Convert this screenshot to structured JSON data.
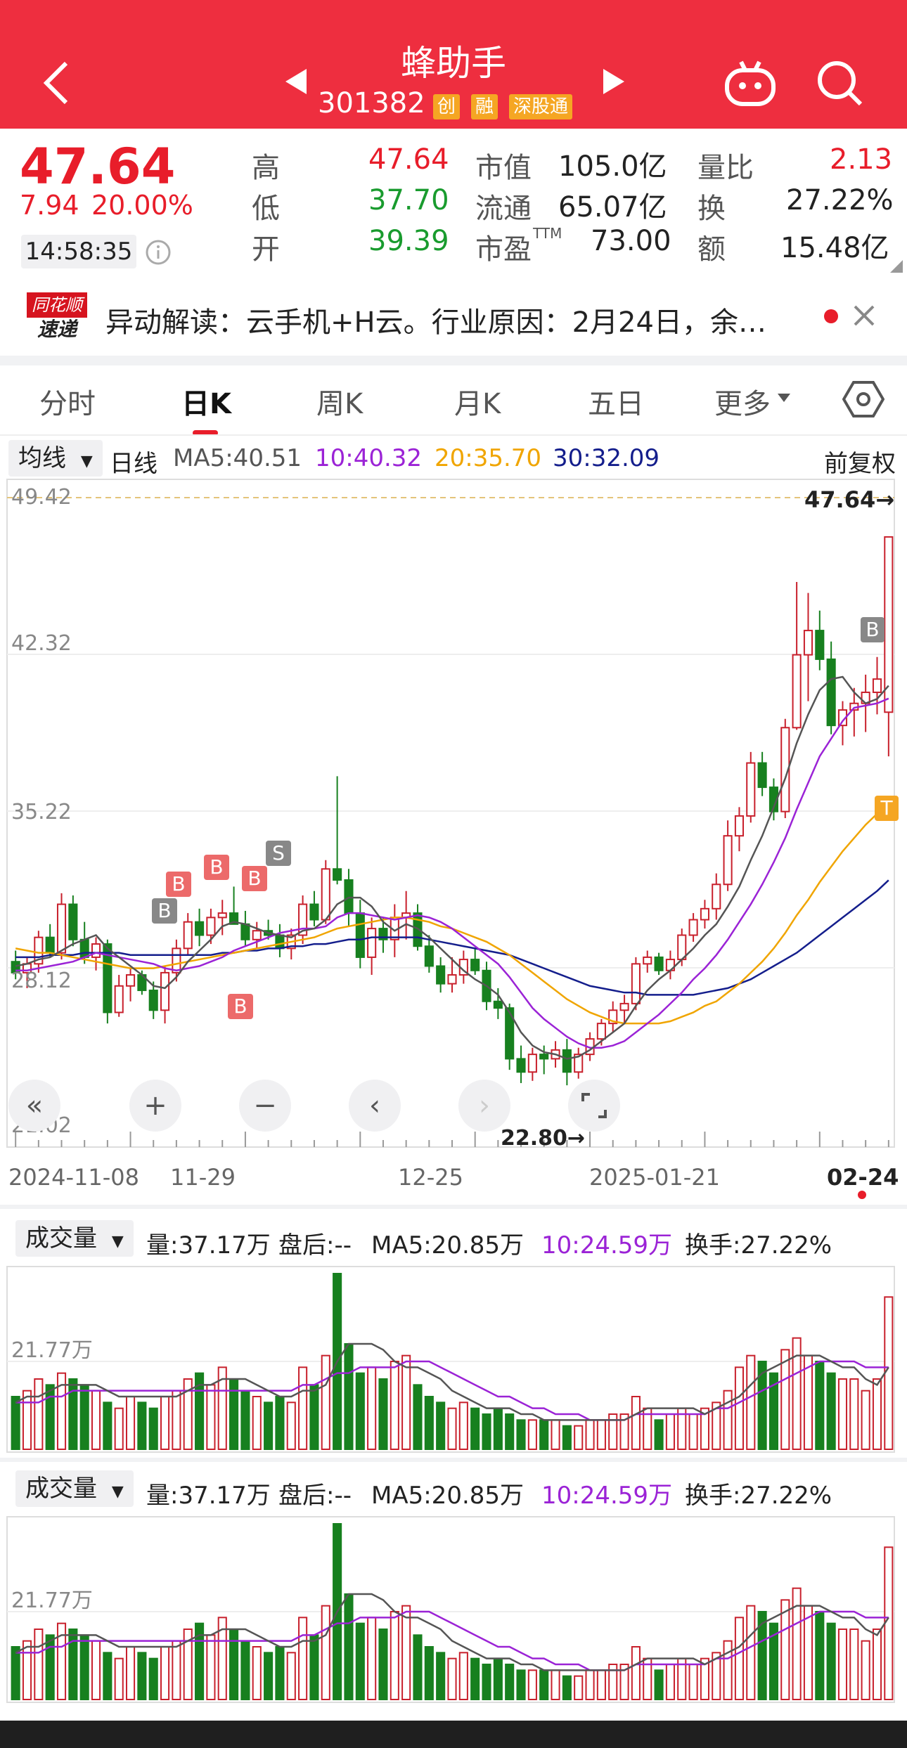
{
  "header": {
    "title": "蜂助手",
    "code": "301382",
    "tags": [
      "创",
      "融",
      "深股通"
    ]
  },
  "quote": {
    "price": "47.64",
    "change": "7.94",
    "change_pct": "20.00%",
    "time": "14:58:35",
    "high_label": "高",
    "high": "47.64",
    "low_label": "低",
    "low": "37.70",
    "open_label": "开",
    "open": "39.39",
    "mktcap_label": "市值",
    "mktcap": "105.0亿",
    "float_label": "流通",
    "float": "65.07亿",
    "pe_label": "市盈",
    "pe_sup": "TTM",
    "pe": "73.00",
    "volratio_label": "量比",
    "volratio": "2.13",
    "turnover_label": "换",
    "turnover": "27.22%",
    "amount_label": "额",
    "amount": "15.48亿"
  },
  "news": {
    "logo_top": "同花顺",
    "logo_bottom": "速递",
    "text": "异动解读：云手机+H云。行业原因：2月24日，余…"
  },
  "tabs": [
    "分时",
    "日K",
    "周K",
    "月K",
    "五日",
    "更多"
  ],
  "active_tab": 1,
  "ma_line": {
    "dropdown": "均线",
    "kind": "日线",
    "ma5": "MA5:40.51",
    "ma10": "10:40.32",
    "ma20": "20:35.70",
    "ma30": "30:32.09",
    "adjust": "前复权"
  },
  "kline": {
    "y_labels": [
      "49.42",
      "42.32",
      "35.22",
      "28.12",
      "21.02"
    ],
    "last_marker": "47.64→",
    "low_marker": "22.80→",
    "dates": [
      "2024-11-08",
      "11-29",
      "12-25",
      "2025-01-21",
      "02-24"
    ],
    "signals": [
      "B",
      "B",
      "B",
      "B",
      "B",
      "S",
      "B",
      "T"
    ]
  },
  "chart_data": {
    "type": "candlestick",
    "ylim": [
      21.02,
      49.42
    ],
    "ohlc": [
      [
        28.4,
        28.9,
        27.6,
        27.9
      ],
      [
        27.9,
        28.6,
        27.2,
        28.3
      ],
      [
        28.3,
        29.8,
        27.9,
        29.5
      ],
      [
        29.5,
        30.1,
        28.6,
        28.8
      ],
      [
        28.8,
        31.5,
        28.5,
        31.0
      ],
      [
        31.0,
        31.4,
        29.1,
        29.4
      ],
      [
        29.4,
        30.2,
        28.3,
        28.6
      ],
      [
        28.6,
        29.5,
        28.0,
        29.2
      ],
      [
        29.2,
        29.4,
        25.6,
        26.1
      ],
      [
        26.1,
        27.8,
        25.9,
        27.3
      ],
      [
        27.3,
        28.1,
        26.6,
        27.8
      ],
      [
        27.8,
        28.0,
        26.9,
        27.1
      ],
      [
        27.1,
        27.5,
        25.8,
        26.2
      ],
      [
        26.2,
        28.2,
        25.6,
        27.9
      ],
      [
        27.9,
        29.4,
        27.5,
        29.0
      ],
      [
        29.0,
        30.6,
        28.7,
        30.2
      ],
      [
        30.2,
        30.8,
        29.1,
        29.6
      ],
      [
        29.6,
        30.8,
        29.2,
        30.4
      ],
      [
        30.4,
        31.2,
        29.6,
        30.6
      ],
      [
        30.6,
        31.8,
        30.2,
        30.1
      ],
      [
        30.1,
        30.7,
        29.1,
        29.4
      ],
      [
        29.4,
        30.2,
        29.0,
        29.8
      ],
      [
        29.8,
        30.3,
        29.4,
        29.6
      ],
      [
        29.6,
        30.1,
        28.6,
        29.0
      ],
      [
        29.0,
        29.9,
        28.5,
        29.6
      ],
      [
        29.6,
        31.4,
        29.2,
        31.0
      ],
      [
        31.0,
        31.6,
        30.0,
        30.3
      ],
      [
        30.3,
        33.0,
        30.1,
        32.6
      ],
      [
        32.6,
        36.8,
        31.9,
        32.1
      ],
      [
        32.1,
        32.6,
        30.0,
        30.6
      ],
      [
        30.6,
        31.2,
        28.1,
        28.6
      ],
      [
        28.6,
        30.4,
        27.8,
        29.9
      ],
      [
        29.9,
        30.4,
        28.8,
        29.4
      ],
      [
        29.4,
        31.0,
        28.6,
        30.4
      ],
      [
        30.4,
        31.6,
        29.4,
        30.6
      ],
      [
        30.6,
        31.0,
        28.9,
        29.1
      ],
      [
        29.1,
        29.6,
        27.9,
        28.2
      ],
      [
        28.2,
        28.6,
        27.0,
        27.4
      ],
      [
        27.4,
        28.6,
        27.0,
        27.8
      ],
      [
        27.8,
        28.9,
        27.4,
        28.5
      ],
      [
        28.5,
        29.0,
        27.8,
        28.0
      ],
      [
        28.0,
        28.4,
        26.2,
        26.6
      ],
      [
        26.6,
        27.2,
        25.8,
        26.3
      ],
      [
        26.3,
        26.5,
        23.5,
        24.0
      ],
      [
        24.0,
        24.6,
        22.9,
        23.4
      ],
      [
        23.4,
        24.5,
        23.0,
        24.2
      ],
      [
        24.2,
        24.6,
        23.3,
        24.0
      ],
      [
        24.0,
        24.8,
        23.6,
        24.4
      ],
      [
        24.4,
        24.9,
        22.8,
        23.4
      ],
      [
        23.4,
        24.5,
        23.1,
        24.2
      ],
      [
        24.2,
        25.2,
        23.9,
        24.9
      ],
      [
        24.9,
        25.8,
        24.6,
        25.6
      ],
      [
        25.6,
        26.6,
        25.2,
        26.2
      ],
      [
        26.2,
        26.9,
        25.6,
        26.5
      ],
      [
        26.5,
        28.6,
        26.2,
        28.3
      ],
      [
        28.3,
        28.9,
        27.9,
        28.6
      ],
      [
        28.6,
        28.8,
        27.8,
        28.0
      ],
      [
        28.0,
        28.9,
        27.6,
        28.5
      ],
      [
        28.5,
        29.9,
        28.2,
        29.6
      ],
      [
        29.6,
        30.6,
        29.3,
        30.3
      ],
      [
        30.3,
        31.2,
        29.9,
        30.8
      ],
      [
        30.8,
        32.4,
        30.3,
        31.9
      ],
      [
        31.9,
        34.8,
        31.6,
        34.1
      ],
      [
        34.1,
        35.4,
        33.4,
        35.0
      ],
      [
        35.0,
        37.9,
        34.7,
        37.4
      ],
      [
        37.4,
        37.9,
        35.9,
        36.3
      ],
      [
        36.3,
        36.7,
        34.8,
        35.2
      ],
      [
        35.2,
        39.4,
        34.9,
        39.0
      ],
      [
        39.0,
        45.6,
        38.9,
        42.3
      ],
      [
        42.3,
        45.1,
        40.2,
        43.4
      ],
      [
        43.4,
        44.3,
        41.6,
        42.1
      ],
      [
        42.1,
        42.9,
        38.7,
        39.1
      ],
      [
        39.1,
        40.2,
        38.2,
        39.8
      ],
      [
        39.8,
        40.8,
        38.6,
        40.1
      ],
      [
        40.1,
        41.4,
        38.8,
        40.6
      ],
      [
        40.6,
        42.2,
        39.6,
        41.2
      ],
      [
        39.7,
        47.64,
        37.7,
        47.64
      ]
    ],
    "ma5": [
      28.2,
      28.3,
      28.5,
      28.6,
      28.9,
      29.2,
      29.4,
      29.6,
      29.0,
      28.6,
      28.2,
      27.8,
      27.3,
      27.2,
      27.7,
      28.4,
      28.9,
      29.4,
      30.0,
      30.2,
      30.1,
      29.9,
      29.7,
      29.6,
      29.5,
      29.8,
      29.9,
      30.3,
      31.0,
      31.3,
      31.3,
      30.9,
      30.2,
      29.8,
      30.1,
      29.9,
      29.5,
      29.0,
      28.5,
      28.0,
      27.6,
      27.3,
      26.9,
      26.1,
      25.2,
      24.6,
      24.3,
      24.2,
      24.0,
      24.1,
      24.4,
      24.8,
      25.2,
      25.6,
      26.4,
      27.1,
      27.6,
      28.0,
      28.5,
      29.0,
      29.6,
      30.1,
      30.9,
      31.8,
      33.0,
      34.1,
      35.4,
      36.7,
      38.3,
      39.6,
      40.7,
      41.2,
      41.3,
      40.6,
      40.1,
      40.3,
      40.9
    ],
    "ma10": [
      28.0,
      28.0,
      28.1,
      28.2,
      28.3,
      28.4,
      28.6,
      28.8,
      28.7,
      28.6,
      28.5,
      28.4,
      28.3,
      28.1,
      28.0,
      28.1,
      28.2,
      28.4,
      28.6,
      28.9,
      29.1,
      29.3,
      29.5,
      29.7,
      29.8,
      29.9,
      29.9,
      30.0,
      30.4,
      30.6,
      30.6,
      30.5,
      30.4,
      30.3,
      30.4,
      30.5,
      30.4,
      30.2,
      29.9,
      29.5,
      29.1,
      28.7,
      28.3,
      27.7,
      27.0,
      26.3,
      25.8,
      25.4,
      25.0,
      24.7,
      24.5,
      24.5,
      24.6,
      24.8,
      25.2,
      25.6,
      26.0,
      26.5,
      27.0,
      27.6,
      28.1,
      28.7,
      29.4,
      30.2,
      31.0,
      31.9,
      32.9,
      34.0,
      35.3,
      36.5,
      37.7,
      38.5,
      39.3,
      39.9,
      40.0,
      40.1,
      40.32
    ],
    "ma20": [
      29.0,
      28.9,
      28.8,
      28.8,
      28.7,
      28.6,
      28.5,
      28.4,
      28.3,
      28.2,
      28.1,
      28.1,
      28.1,
      28.2,
      28.3,
      28.4,
      28.5,
      28.6,
      28.7,
      28.8,
      28.9,
      29.0,
      29.1,
      29.2,
      29.3,
      29.4,
      29.5,
      29.7,
      29.9,
      30.0,
      30.1,
      30.2,
      30.3,
      30.4,
      30.4,
      30.3,
      30.2,
      30.0,
      29.9,
      29.7,
      29.5,
      29.3,
      29.0,
      28.7,
      28.3,
      27.9,
      27.5,
      27.1,
      26.7,
      26.4,
      26.1,
      25.9,
      25.7,
      25.6,
      25.6,
      25.6,
      25.6,
      25.7,
      25.9,
      26.1,
      26.4,
      26.6,
      27.0,
      27.4,
      27.9,
      28.4,
      29.0,
      29.7,
      30.5,
      31.2,
      32.0,
      32.7,
      33.4,
      34.0,
      34.6,
      35.1,
      35.7
    ],
    "ma30": [
      28.6,
      28.6,
      28.6,
      28.7,
      28.7,
      28.7,
      28.8,
      28.8,
      28.8,
      28.8,
      28.7,
      28.7,
      28.7,
      28.7,
      28.7,
      28.7,
      28.7,
      28.7,
      28.8,
      28.8,
      28.9,
      28.9,
      29.0,
      29.0,
      29.1,
      29.1,
      29.2,
      29.2,
      29.3,
      29.4,
      29.4,
      29.5,
      29.5,
      29.5,
      29.5,
      29.5,
      29.4,
      29.3,
      29.2,
      29.1,
      29.0,
      28.9,
      28.8,
      28.7,
      28.5,
      28.3,
      28.1,
      27.9,
      27.7,
      27.5,
      27.3,
      27.2,
      27.1,
      27.0,
      27.0,
      26.9,
      26.9,
      26.9,
      26.9,
      26.9,
      27.0,
      27.1,
      27.2,
      27.4,
      27.6,
      27.9,
      28.2,
      28.5,
      28.8,
      29.2,
      29.6,
      30.0,
      30.4,
      30.8,
      31.2,
      31.6,
      32.09
    ],
    "volume": [
      9,
      10,
      12,
      11,
      13,
      12,
      11,
      10,
      8,
      7,
      9,
      8,
      7,
      9,
      10,
      12,
      13,
      11,
      14,
      12,
      10,
      9,
      8,
      9,
      8,
      14,
      11,
      16,
      30,
      18,
      13,
      14,
      12,
      15,
      16,
      11,
      9,
      8,
      7,
      8,
      7,
      6,
      7,
      6,
      5,
      5,
      5,
      5,
      4,
      4,
      5,
      5,
      6,
      6,
      9,
      7,
      5,
      6,
      7,
      6,
      7,
      8,
      10,
      14,
      16,
      15,
      13,
      17,
      19,
      16,
      15,
      13,
      12,
      12,
      10,
      12,
      26
    ],
    "vol_ma5": [
      8,
      9,
      9,
      10,
      11,
      11,
      11,
      11,
      10,
      9,
      9,
      9,
      9,
      9,
      9,
      10,
      11,
      11,
      12,
      12,
      12,
      11,
      10,
      9,
      9,
      10,
      10,
      11,
      15,
      18,
      18,
      18,
      17,
      15,
      14,
      14,
      13,
      12,
      10,
      9,
      8,
      7,
      7,
      7,
      6,
      6,
      5,
      5,
      5,
      5,
      5,
      5,
      5,
      5,
      6,
      7,
      7,
      7,
      7,
      7,
      6,
      7,
      8,
      9,
      11,
      13,
      14,
      15,
      16,
      16,
      16,
      15,
      14,
      14,
      12,
      11,
      14
    ],
    "vol_ma10": [
      8,
      8,
      8,
      9,
      9,
      10,
      10,
      10,
      10,
      10,
      10,
      10,
      10,
      10,
      10,
      10,
      10,
      10,
      10,
      10,
      10,
      10,
      10,
      10,
      10,
      11,
      11,
      12,
      13,
      13,
      14,
      14,
      14,
      14,
      15,
      15,
      15,
      14,
      13,
      12,
      11,
      10,
      9,
      9,
      8,
      7,
      7,
      6,
      6,
      6,
      5,
      5,
      5,
      5,
      6,
      6,
      6,
      6,
      6,
      6,
      6,
      7,
      7,
      8,
      9,
      10,
      11,
      12,
      13,
      14,
      15,
      15,
      15,
      15,
      14,
      14,
      14
    ]
  },
  "volume_panels": [
    {
      "dropdown": "成交量",
      "vol": "量:37.17万",
      "after": "盘后:--",
      "ma5": "MA5:20.85万",
      "ma10": "10:24.59万",
      "turnover": "换手:27.22%",
      "y_label": "21.77万"
    },
    {
      "dropdown": "成交量",
      "vol": "量:37.17万",
      "after": "盘后:--",
      "ma5": "MA5:20.85万",
      "ma10": "10:24.59万",
      "turnover": "换手:27.22%",
      "y_label": "21.77万"
    }
  ],
  "colors": {
    "header": "#ee2e3f",
    "up": "#c8202c",
    "down": "#17801f",
    "ma5": "#555555",
    "ma10": "#9b23d6",
    "ma20": "#f0a500",
    "ma30": "#141e8c"
  },
  "icons": [
    "back-icon",
    "prev-icon",
    "next-icon",
    "robot-icon",
    "search-icon",
    "settings-hex-icon",
    "close-icon"
  ]
}
